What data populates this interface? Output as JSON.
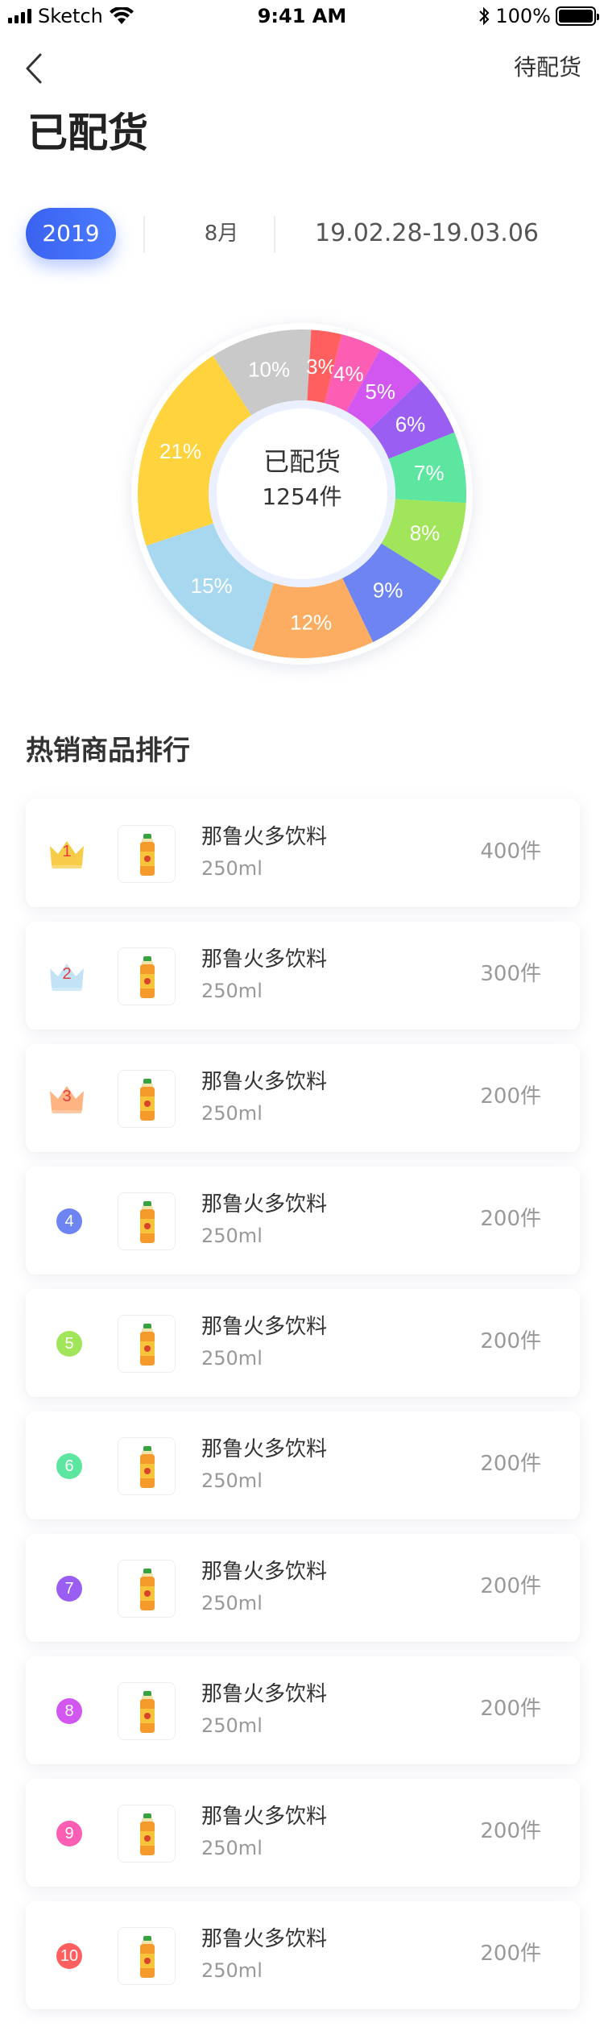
{
  "status_bar": {
    "carrier": "Sketch",
    "time": "9:41 AM",
    "battery": "100%"
  },
  "nav": {
    "action": "待配货"
  },
  "page_title": "已配货",
  "filters": {
    "year": "2019",
    "month": "8月",
    "range": "19.02.28-19.03.06"
  },
  "donut": {
    "center_title": "已配货",
    "center_value": "1254件"
  },
  "chart_data": {
    "type": "pie",
    "categories": [
      "",
      "",
      "",
      "",
      "",
      "",
      "",
      "",
      "",
      "",
      ""
    ],
    "values": [
      7,
      8,
      9,
      12,
      15,
      21,
      10,
      3,
      4,
      5,
      6
    ],
    "labels": [
      "7%",
      "8%",
      "9%",
      "12%",
      "15%",
      "21%",
      "10%",
      "3%",
      "4%",
      "5%",
      "6%"
    ],
    "colors": [
      "#5de6a0",
      "#a1e55a",
      "#6f84f3",
      "#fcad62",
      "#a8d8ef",
      "#ffd33d",
      "#c9c9c9",
      "#ff5f5f",
      "#fc5eb3",
      "#d257f0",
      "#9a5ff2"
    ],
    "start_angle_deg": -22
  },
  "ranking": {
    "title": "热销商品排行",
    "items": [
      {
        "rank": "1",
        "name": "那鲁火多饮料",
        "spec": "250ml",
        "qty": "400件",
        "badge": "crown",
        "color": "#f7c93e"
      },
      {
        "rank": "2",
        "name": "那鲁火多饮料",
        "spec": "250ml",
        "qty": "300件",
        "badge": "crown",
        "color": "#bfe0f5"
      },
      {
        "rank": "3",
        "name": "那鲁火多饮料",
        "spec": "250ml",
        "qty": "200件",
        "badge": "crown",
        "color": "#ffb07a"
      },
      {
        "rank": "4",
        "name": "那鲁火多饮料",
        "spec": "250ml",
        "qty": "200件",
        "badge": "circle",
        "color": "#6f84f3"
      },
      {
        "rank": "5",
        "name": "那鲁火多饮料",
        "spec": "250ml",
        "qty": "200件",
        "badge": "circle",
        "color": "#a1e55a"
      },
      {
        "rank": "6",
        "name": "那鲁火多饮料",
        "spec": "250ml",
        "qty": "200件",
        "badge": "circle",
        "color": "#5de6a0"
      },
      {
        "rank": "7",
        "name": "那鲁火多饮料",
        "spec": "250ml",
        "qty": "200件",
        "badge": "circle",
        "color": "#9a5ff2"
      },
      {
        "rank": "8",
        "name": "那鲁火多饮料",
        "spec": "250ml",
        "qty": "200件",
        "badge": "circle",
        "color": "#d257f0"
      },
      {
        "rank": "9",
        "name": "那鲁火多饮料",
        "spec": "250ml",
        "qty": "200件",
        "badge": "circle",
        "color": "#fc5eb3"
      },
      {
        "rank": "10",
        "name": "那鲁火多饮料",
        "spec": "250ml",
        "qty": "200件",
        "badge": "circle",
        "color": "#ff5f5f"
      }
    ]
  }
}
